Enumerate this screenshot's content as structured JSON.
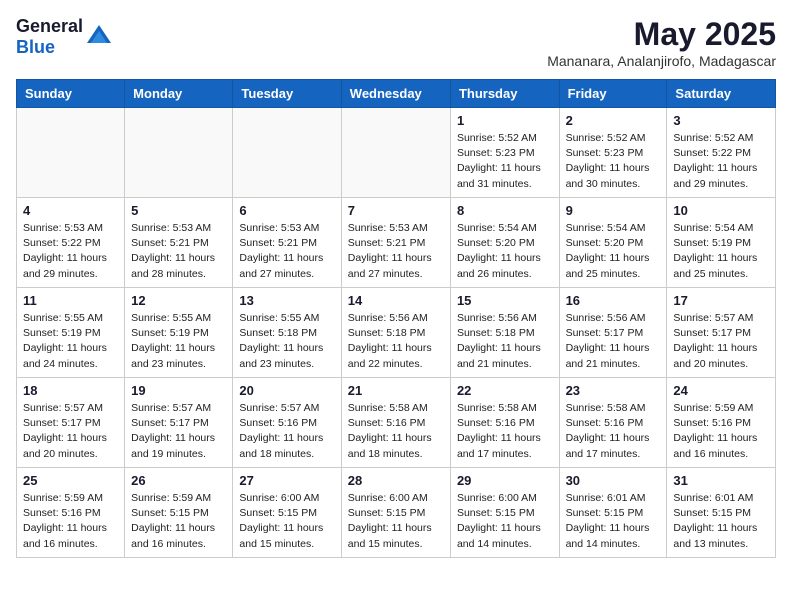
{
  "header": {
    "logo_general": "General",
    "logo_blue": "Blue",
    "month": "May 2025",
    "location": "Mananara, Analanjirofo, Madagascar"
  },
  "days_of_week": [
    "Sunday",
    "Monday",
    "Tuesday",
    "Wednesday",
    "Thursday",
    "Friday",
    "Saturday"
  ],
  "weeks": [
    [
      {
        "day": "",
        "info": ""
      },
      {
        "day": "",
        "info": ""
      },
      {
        "day": "",
        "info": ""
      },
      {
        "day": "",
        "info": ""
      },
      {
        "day": "1",
        "info": "Sunrise: 5:52 AM\nSunset: 5:23 PM\nDaylight: 11 hours and 31 minutes."
      },
      {
        "day": "2",
        "info": "Sunrise: 5:52 AM\nSunset: 5:23 PM\nDaylight: 11 hours and 30 minutes."
      },
      {
        "day": "3",
        "info": "Sunrise: 5:52 AM\nSunset: 5:22 PM\nDaylight: 11 hours and 29 minutes."
      }
    ],
    [
      {
        "day": "4",
        "info": "Sunrise: 5:53 AM\nSunset: 5:22 PM\nDaylight: 11 hours and 29 minutes."
      },
      {
        "day": "5",
        "info": "Sunrise: 5:53 AM\nSunset: 5:21 PM\nDaylight: 11 hours and 28 minutes."
      },
      {
        "day": "6",
        "info": "Sunrise: 5:53 AM\nSunset: 5:21 PM\nDaylight: 11 hours and 27 minutes."
      },
      {
        "day": "7",
        "info": "Sunrise: 5:53 AM\nSunset: 5:21 PM\nDaylight: 11 hours and 27 minutes."
      },
      {
        "day": "8",
        "info": "Sunrise: 5:54 AM\nSunset: 5:20 PM\nDaylight: 11 hours and 26 minutes."
      },
      {
        "day": "9",
        "info": "Sunrise: 5:54 AM\nSunset: 5:20 PM\nDaylight: 11 hours and 25 minutes."
      },
      {
        "day": "10",
        "info": "Sunrise: 5:54 AM\nSunset: 5:19 PM\nDaylight: 11 hours and 25 minutes."
      }
    ],
    [
      {
        "day": "11",
        "info": "Sunrise: 5:55 AM\nSunset: 5:19 PM\nDaylight: 11 hours and 24 minutes."
      },
      {
        "day": "12",
        "info": "Sunrise: 5:55 AM\nSunset: 5:19 PM\nDaylight: 11 hours and 23 minutes."
      },
      {
        "day": "13",
        "info": "Sunrise: 5:55 AM\nSunset: 5:18 PM\nDaylight: 11 hours and 23 minutes."
      },
      {
        "day": "14",
        "info": "Sunrise: 5:56 AM\nSunset: 5:18 PM\nDaylight: 11 hours and 22 minutes."
      },
      {
        "day": "15",
        "info": "Sunrise: 5:56 AM\nSunset: 5:18 PM\nDaylight: 11 hours and 21 minutes."
      },
      {
        "day": "16",
        "info": "Sunrise: 5:56 AM\nSunset: 5:17 PM\nDaylight: 11 hours and 21 minutes."
      },
      {
        "day": "17",
        "info": "Sunrise: 5:57 AM\nSunset: 5:17 PM\nDaylight: 11 hours and 20 minutes."
      }
    ],
    [
      {
        "day": "18",
        "info": "Sunrise: 5:57 AM\nSunset: 5:17 PM\nDaylight: 11 hours and 20 minutes."
      },
      {
        "day": "19",
        "info": "Sunrise: 5:57 AM\nSunset: 5:17 PM\nDaylight: 11 hours and 19 minutes."
      },
      {
        "day": "20",
        "info": "Sunrise: 5:57 AM\nSunset: 5:16 PM\nDaylight: 11 hours and 18 minutes."
      },
      {
        "day": "21",
        "info": "Sunrise: 5:58 AM\nSunset: 5:16 PM\nDaylight: 11 hours and 18 minutes."
      },
      {
        "day": "22",
        "info": "Sunrise: 5:58 AM\nSunset: 5:16 PM\nDaylight: 11 hours and 17 minutes."
      },
      {
        "day": "23",
        "info": "Sunrise: 5:58 AM\nSunset: 5:16 PM\nDaylight: 11 hours and 17 minutes."
      },
      {
        "day": "24",
        "info": "Sunrise: 5:59 AM\nSunset: 5:16 PM\nDaylight: 11 hours and 16 minutes."
      }
    ],
    [
      {
        "day": "25",
        "info": "Sunrise: 5:59 AM\nSunset: 5:16 PM\nDaylight: 11 hours and 16 minutes."
      },
      {
        "day": "26",
        "info": "Sunrise: 5:59 AM\nSunset: 5:15 PM\nDaylight: 11 hours and 16 minutes."
      },
      {
        "day": "27",
        "info": "Sunrise: 6:00 AM\nSunset: 5:15 PM\nDaylight: 11 hours and 15 minutes."
      },
      {
        "day": "28",
        "info": "Sunrise: 6:00 AM\nSunset: 5:15 PM\nDaylight: 11 hours and 15 minutes."
      },
      {
        "day": "29",
        "info": "Sunrise: 6:00 AM\nSunset: 5:15 PM\nDaylight: 11 hours and 14 minutes."
      },
      {
        "day": "30",
        "info": "Sunrise: 6:01 AM\nSunset: 5:15 PM\nDaylight: 11 hours and 14 minutes."
      },
      {
        "day": "31",
        "info": "Sunrise: 6:01 AM\nSunset: 5:15 PM\nDaylight: 11 hours and 13 minutes."
      }
    ]
  ]
}
